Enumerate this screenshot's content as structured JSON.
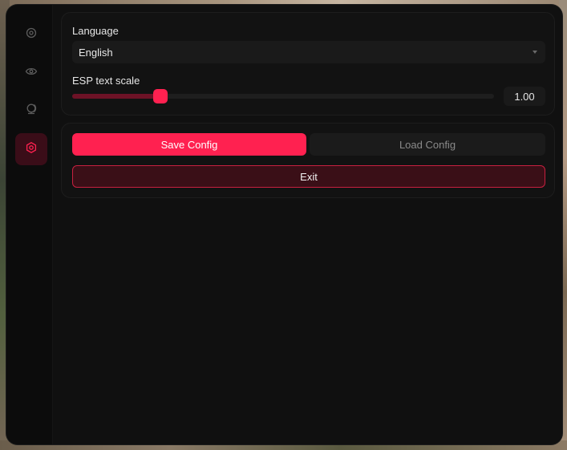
{
  "sidebar": {
    "items": [
      {
        "icon": "crosshair-icon",
        "active": false
      },
      {
        "icon": "eye-icon",
        "active": false
      },
      {
        "icon": "globe-icon",
        "active": false
      },
      {
        "icon": "settings-icon",
        "active": true
      }
    ]
  },
  "settings": {
    "language_label": "Language",
    "language_value": "English",
    "esp_scale_label": "ESP text scale",
    "esp_scale_value": "1.00",
    "esp_scale_fraction": 0.21
  },
  "config": {
    "save_label": "Save Config",
    "load_label": "Load Config",
    "exit_label": "Exit"
  },
  "colors": {
    "accent": "#ff2150",
    "accent_dark": "#6d1226",
    "panel": "#121212",
    "background": "#101010"
  }
}
